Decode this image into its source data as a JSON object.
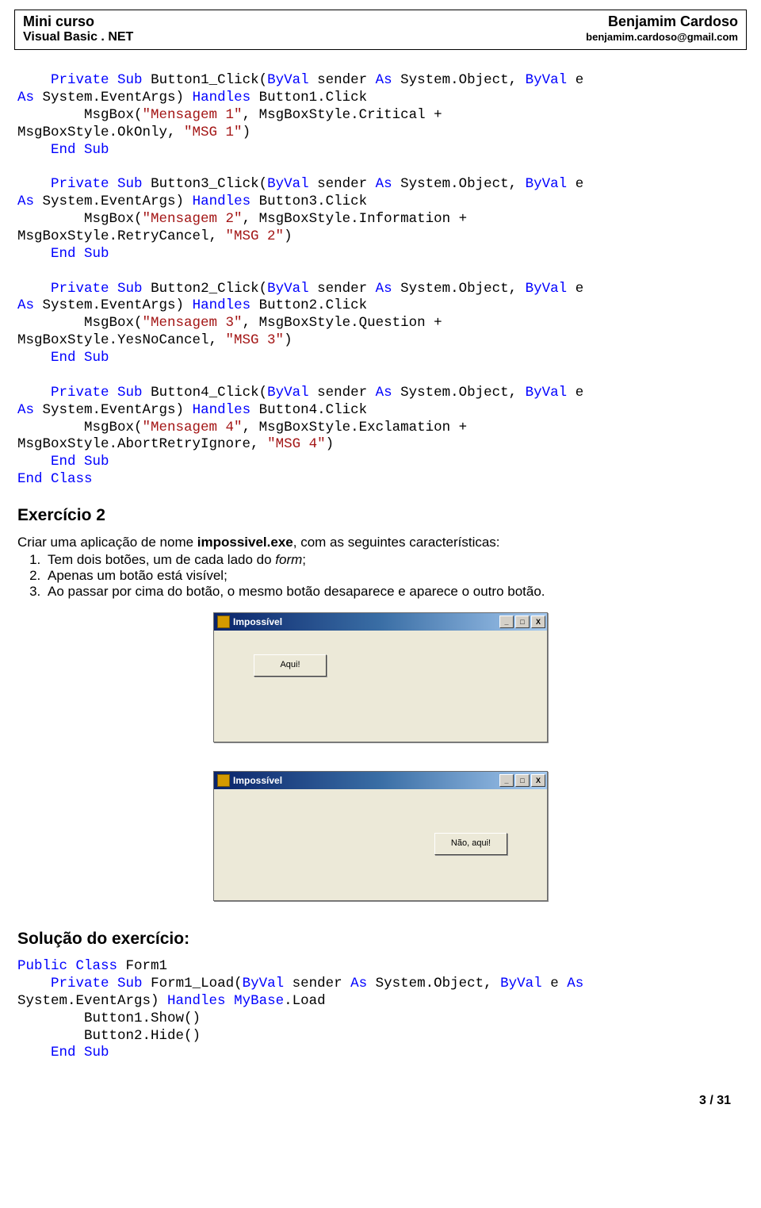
{
  "header": {
    "title_left": "Mini curso",
    "subtitle_left": "Visual Basic . NET",
    "title_right": "Benjamim Cardoso",
    "subtitle_right": "benjamim.cardoso@gmail.com"
  },
  "code_block_1": {
    "sub1_decl_pre": "    ",
    "kw_private": "Private",
    "kw_sub": "Sub",
    "kw_byval": "ByVal",
    "kw_as": "As",
    "kw_handles": "Handles",
    "kw_end": "End",
    "kw_class": "Class",
    "name1": " Button1_Click(",
    "arg_sender": " sender ",
    "sys_obj": " System.Object, ",
    "arg_e": " e ",
    "as_line2": "As",
    "sys_evt": " System.EventArgs) ",
    "handles1": " Button1.Click",
    "msg1_pre": "        MsgBox(",
    "msg1_str": "\"Mensagem 1\"",
    "msg1_mid": ", MsgBoxStyle.Critical + ",
    "msg1_cont": "MsgBoxStyle.OkOnly, ",
    "msg1_str2": "\"MSG 1\"",
    "msg1_end": ")",
    "end_sub_pre": "    ",
    "name3": " Button3_Click(",
    "handles3": " Button3.Click",
    "msg3_str": "\"Mensagem 2\"",
    "msg3_mid": ", MsgBoxStyle.Information + ",
    "msg3_cont": "MsgBoxStyle.RetryCancel, ",
    "msg3_str2": "\"MSG 2\"",
    "name2": " Button2_Click(",
    "handles2": " Button2.Click",
    "msg2_str": "\"Mensagem 3\"",
    "msg2_mid": ", MsgBoxStyle.Question + ",
    "msg2_cont": "MsgBoxStyle.YesNoCancel, ",
    "msg2_str2": "\"MSG 3\"",
    "name4": " Button4_Click(",
    "handles4": " Button4.Click",
    "msg4_str": "\"Mensagem 4\"",
    "msg4_mid": ", MsgBoxStyle.Exclamation + ",
    "msg4_cont": "MsgBoxStyle.AbortRetryIgnore, ",
    "msg4_str2": "\"MSG 4\""
  },
  "exercise": {
    "heading": "Exercício 2",
    "intro_pre": "Criar uma aplicação de nome ",
    "intro_bold": "impossivel.exe",
    "intro_post": ", com as seguintes características:",
    "item1_pre": "Tem dois botões, um de cada lado do ",
    "item1_it": "form",
    "item1_post": ";",
    "item2": "Apenas um botão está visível;",
    "item3": "Ao passar por cima do botão, o mesmo botão desaparece e aparece o outro botão."
  },
  "window": {
    "title": "Impossível",
    "min": "_",
    "max": "□",
    "close": "X",
    "btn1": "Aqui!",
    "btn2": "Não, aqui!"
  },
  "solution": {
    "heading": "Solução do exercício:",
    "kw_public": "Public",
    "kw_class": "Class",
    "kw_private": "Private",
    "kw_sub": "Sub",
    "kw_byval": "ByVal",
    "kw_as": "As",
    "kw_handles": "Handles",
    "kw_end": "End",
    "kw_mybase": "MyBase",
    "cls_name": " Form1",
    "load_name": " Form1_Load(",
    "arg_sender": " sender ",
    "sys_obj": " System.Object, ",
    "arg_e": " e ",
    "sys_evt": "System.EventArgs) ",
    "load_suffix": ".Load",
    "body1": "        Button1.Show()",
    "body2": "        Button2.Hide()",
    "end_sub_pre": "    "
  },
  "footer": {
    "page": "3 / 31"
  }
}
